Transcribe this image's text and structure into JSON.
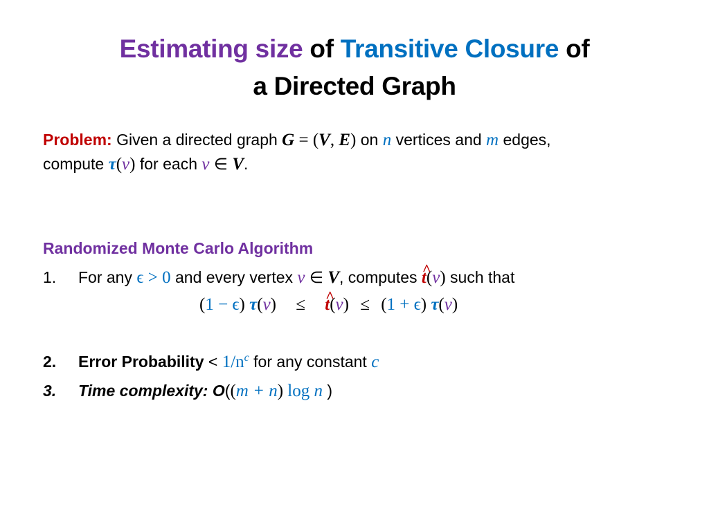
{
  "title": {
    "part1": "Estimating size",
    "part2": " of ",
    "part3": "Transitive Closure",
    "part4": " of",
    "line2": "a Directed Graph"
  },
  "problem": {
    "label": "Problem:",
    "text1": " Given a directed graph ",
    "G": "G",
    "eq": " = (",
    "V": "V",
    "comma": ", ",
    "E": "E",
    "close": ")",
    "text2": " on ",
    "n": "n",
    "text3": " vertices and ",
    "m": "m",
    "text4": " edges,",
    "line2_text1": "compute ",
    "tau": "τ",
    "paren_open": "(",
    "v": "v",
    "paren_close": ")",
    "line2_text2": " for each ",
    "elem": " ∈ ",
    "period": "."
  },
  "algorithm": {
    "heading": "Randomized Monte Carlo Algorithm",
    "items": [
      {
        "num": "1.",
        "text1": "For any ",
        "eps_cond": "ϵ > 0",
        "text2": " and every vertex ",
        "v": "v",
        "elem": " ∈ ",
        "V": "V",
        "text3": ", computes ",
        "that": "t",
        "paren_open": "(",
        "paren_close": ")",
        "text4": " such that"
      },
      {
        "num": "2.",
        "label": "Error Probability",
        "lt": " < ",
        "bound": "1/n",
        "bound_sup": "c",
        "text": " for any constant ",
        "c": "c"
      },
      {
        "num": "3.",
        "label": "Time complexity: O",
        "open": "(",
        "expr_open": "(",
        "expr": "m + n",
        "expr_close": ")",
        "log": " log ",
        "n": "n",
        "close": " )"
      }
    ],
    "inequality": {
      "lparen1": "(",
      "lhs": "1 − ϵ",
      "rparen1": ")",
      "tau": "τ",
      "v": "v",
      "leq": "≤",
      "that": "t",
      "lparen2": "(",
      "rhs": "1 + ϵ",
      "rparen2": ")"
    }
  },
  "colors": {
    "purple": "#7030a0",
    "blue": "#0070c0",
    "red": "#c00000",
    "black": "#000000"
  }
}
